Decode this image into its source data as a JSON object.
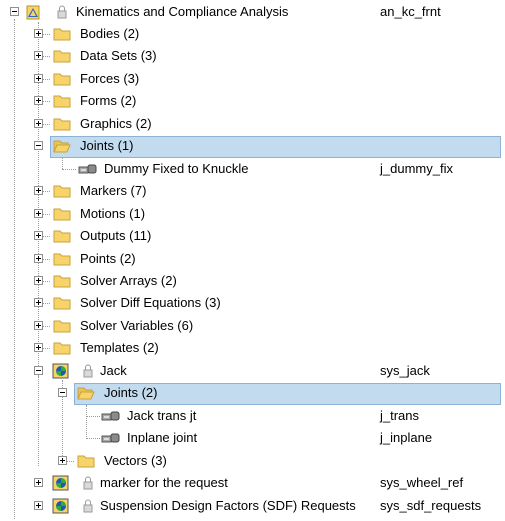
{
  "tree": {
    "root": {
      "label": "Kinematics and Compliance Analysis",
      "var": "an_kc_frnt",
      "icon": "analysis-icon"
    },
    "top_folders_a": [
      {
        "label": "Bodies (2)"
      },
      {
        "label": "Data Sets (3)"
      },
      {
        "label": "Forces (3)"
      },
      {
        "label": "Forms (2)"
      },
      {
        "label": "Graphics (2)"
      }
    ],
    "joints_folder": {
      "label": "Joints (1)",
      "selected": true
    },
    "joint_item": {
      "label": "Dummy Fixed to Knuckle",
      "var": "j_dummy_fix",
      "icon": "joint-icon"
    },
    "top_folders_b": [
      {
        "label": "Markers (7)"
      },
      {
        "label": "Motions (1)"
      },
      {
        "label": "Outputs (11)"
      },
      {
        "label": "Points (2)"
      },
      {
        "label": "Solver Arrays (2)"
      },
      {
        "label": "Solver Diff Equations (3)"
      },
      {
        "label": "Solver Variables (6)"
      },
      {
        "label": "Templates (2)"
      }
    ],
    "jack": {
      "label": "Jack",
      "var": "sys_jack",
      "icon": "system-icon"
    },
    "jack_joints_folder": {
      "label": "Joints (2)",
      "selected": true
    },
    "jack_joints": [
      {
        "label": "Jack trans jt",
        "var": "j_trans"
      },
      {
        "label": "Inplane joint",
        "var": "j_inplane"
      }
    ],
    "jack_vectors": {
      "label": "Vectors (3)"
    },
    "marker_request": {
      "label": "marker for the request",
      "var": "sys_wheel_ref"
    },
    "sdf_requests": {
      "label": "Suspension Design Factors (SDF) Requests",
      "var": "sys_sdf_requests"
    }
  },
  "colors": {
    "selection_bg": "#c3dbef",
    "selection_border": "#8db2d6",
    "folder_yellow": "#f6d46a"
  }
}
